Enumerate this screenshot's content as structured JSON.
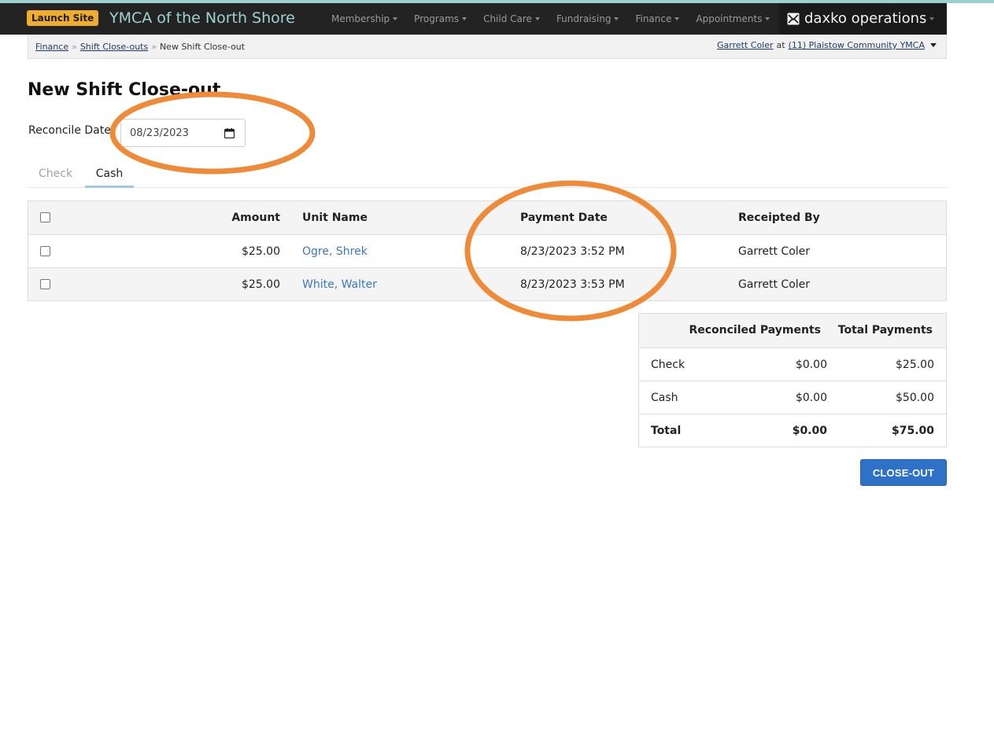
{
  "header": {
    "launch_label": "Launch Site",
    "org_name": "YMCA of the North Shore",
    "menu": [
      {
        "label": "Membership"
      },
      {
        "label": "Programs"
      },
      {
        "label": "Child Care"
      },
      {
        "label": "Fundraising"
      },
      {
        "label": "Finance"
      },
      {
        "label": "Appointments"
      }
    ],
    "brand": "daxko operations"
  },
  "breadcrumb": {
    "items": [
      "Finance",
      "Shift Close-outs"
    ],
    "current": "New Shift Close-out",
    "separator": "»"
  },
  "user": {
    "name": "Garrett Coler",
    "at": "at",
    "location": "(11) Plaistow Community YMCA"
  },
  "page": {
    "title": "New Shift Close-out",
    "reconcile_label": "Reconcile Date",
    "reconcile_date": "08/23/2023"
  },
  "tabs": [
    {
      "label": "Check",
      "active": false
    },
    {
      "label": "Cash",
      "active": true
    }
  ],
  "payments": {
    "columns": [
      "Amount",
      "Unit Name",
      "Payment Date",
      "Receipted By"
    ],
    "rows": [
      {
        "amount": "$25.00",
        "unit_name": "Ogre, Shrek",
        "payment_date": "8/23/2023 3:52 PM",
        "receipted_by": "Garrett Coler"
      },
      {
        "amount": "$25.00",
        "unit_name": "White, Walter",
        "payment_date": "8/23/2023 3:53 PM",
        "receipted_by": "Garrett Coler"
      }
    ]
  },
  "summary": {
    "columns": [
      "Reconciled Payments",
      "Total Payments"
    ],
    "rows": [
      {
        "name": "Check",
        "reconciled": "$0.00",
        "total": "$25.00"
      },
      {
        "name": "Cash",
        "reconciled": "$0.00",
        "total": "$50.00"
      },
      {
        "name": "Total",
        "reconciled": "$0.00",
        "total": "$75.00"
      }
    ]
  },
  "actions": {
    "close_out_label": "CLOSE-OUT"
  },
  "colors": {
    "accent": "#2e72c7",
    "annotation": "#ee8a38",
    "link": "#3a78bf",
    "launch": "#f0ac2d"
  }
}
